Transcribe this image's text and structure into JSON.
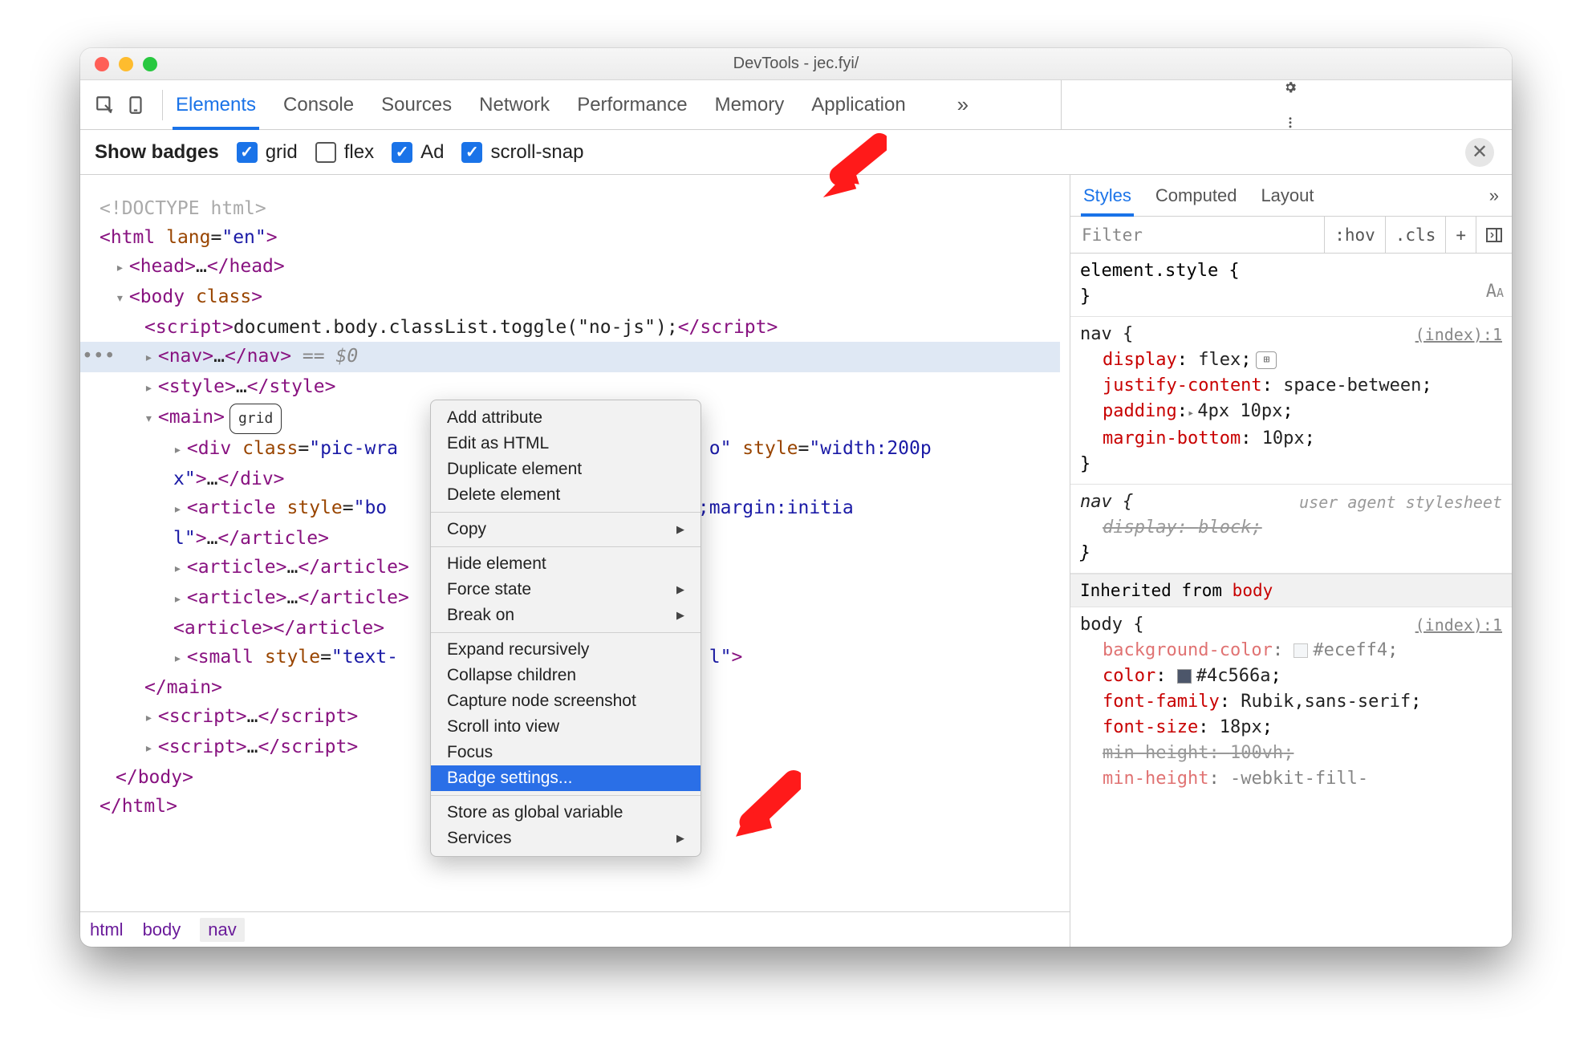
{
  "window": {
    "title": "DevTools - jec.fyi/"
  },
  "topbar": {
    "tabs": [
      "Elements",
      "Console",
      "Sources",
      "Network",
      "Performance",
      "Memory",
      "Application"
    ],
    "active": "Elements"
  },
  "badges": {
    "label": "Show badges",
    "items": [
      {
        "label": "grid",
        "checked": true
      },
      {
        "label": "flex",
        "checked": false
      },
      {
        "label": "Ad",
        "checked": true
      },
      {
        "label": "scroll-snap",
        "checked": true
      }
    ]
  },
  "dom": {
    "doctype": "<!DOCTYPE html>",
    "html_open": {
      "tag": "html",
      "attr": "lang",
      "val": "\"en\""
    },
    "head": "head",
    "body_open": {
      "tag": "body",
      "attr": "class"
    },
    "script_inline": {
      "tag": "script",
      "content": "document.body.classList.toggle(\"no-js\");"
    },
    "nav_sel": {
      "tag": "nav",
      "suffix": " == $0"
    },
    "style": "style",
    "main": {
      "tag": "main",
      "badge": "grid"
    },
    "div": {
      "tag": "div",
      "attr": "class",
      "val1": "\"pic-wra",
      "attr2": "style",
      "val2": "\"width:200p",
      "cont": "x\""
    },
    "article1": {
      "tag": "article",
      "attr": "style",
      "val": "\"bo",
      "val2": "nitial;margin:initia",
      "cont": "l\""
    },
    "article2": "article",
    "article3": "article",
    "article_empty": "article",
    "small": {
      "tag": "small",
      "attr": "style",
      "val": "\"text-",
      "tail": "l\""
    },
    "main_close": "main",
    "script_close": "script",
    "body_close": "body",
    "html_close": "html"
  },
  "crumbs": [
    "html",
    "body",
    "nav"
  ],
  "context_menu": {
    "groups": [
      [
        "Add attribute",
        "Edit as HTML",
        "Duplicate element",
        "Delete element"
      ],
      [
        {
          "label": "Copy",
          "sub": true
        }
      ],
      [
        "Hide element",
        {
          "label": "Force state",
          "sub": true
        },
        {
          "label": "Break on",
          "sub": true
        }
      ],
      [
        "Expand recursively",
        "Collapse children",
        "Capture node screenshot",
        "Scroll into view",
        "Focus",
        {
          "label": "Badge settings...",
          "selected": true
        }
      ],
      [
        "Store as global variable",
        {
          "label": "Services",
          "sub": true
        }
      ]
    ]
  },
  "right": {
    "tabs": [
      "Styles",
      "Computed",
      "Layout"
    ],
    "active": "Styles",
    "filter": {
      "placeholder": "Filter",
      "hov": ":hov",
      "cls": ".cls"
    },
    "rules": {
      "elstyle_open": "element.style {",
      "elstyle_close": "}",
      "nav": {
        "selector": "nav {",
        "source": "(index):1",
        "props": [
          {
            "name": "display",
            "val": "flex",
            "chip": true
          },
          {
            "name": "justify-content",
            "val": "space-between"
          },
          {
            "name": "padding",
            "val": "4px 10px",
            "tri": true
          },
          {
            "name": "margin-bottom",
            "val": "10px"
          }
        ],
        "close": "}"
      },
      "nav_ua": {
        "selector": "nav {",
        "note": "user agent stylesheet",
        "prop": {
          "name": "display",
          "val": "block"
        },
        "close": "}"
      },
      "inherit_label": "Inherited from",
      "inherit_sel": "body",
      "body": {
        "selector": "body {",
        "source": "(index):1",
        "props": [
          {
            "name": "background-color",
            "val": "#eceff4",
            "swatch": "#eceff4",
            "fade": true
          },
          {
            "name": "color",
            "val": "#4c566a",
            "swatch": "#4c566a"
          },
          {
            "name": "font-family",
            "val": "Rubik,sans-serif"
          },
          {
            "name": "font-size",
            "val": "18px"
          },
          {
            "name": "min-height",
            "val": "100vh",
            "strike": true
          },
          {
            "name": "min-height",
            "val": "-webkit-fill-",
            "fade": true
          }
        ]
      }
    }
  }
}
